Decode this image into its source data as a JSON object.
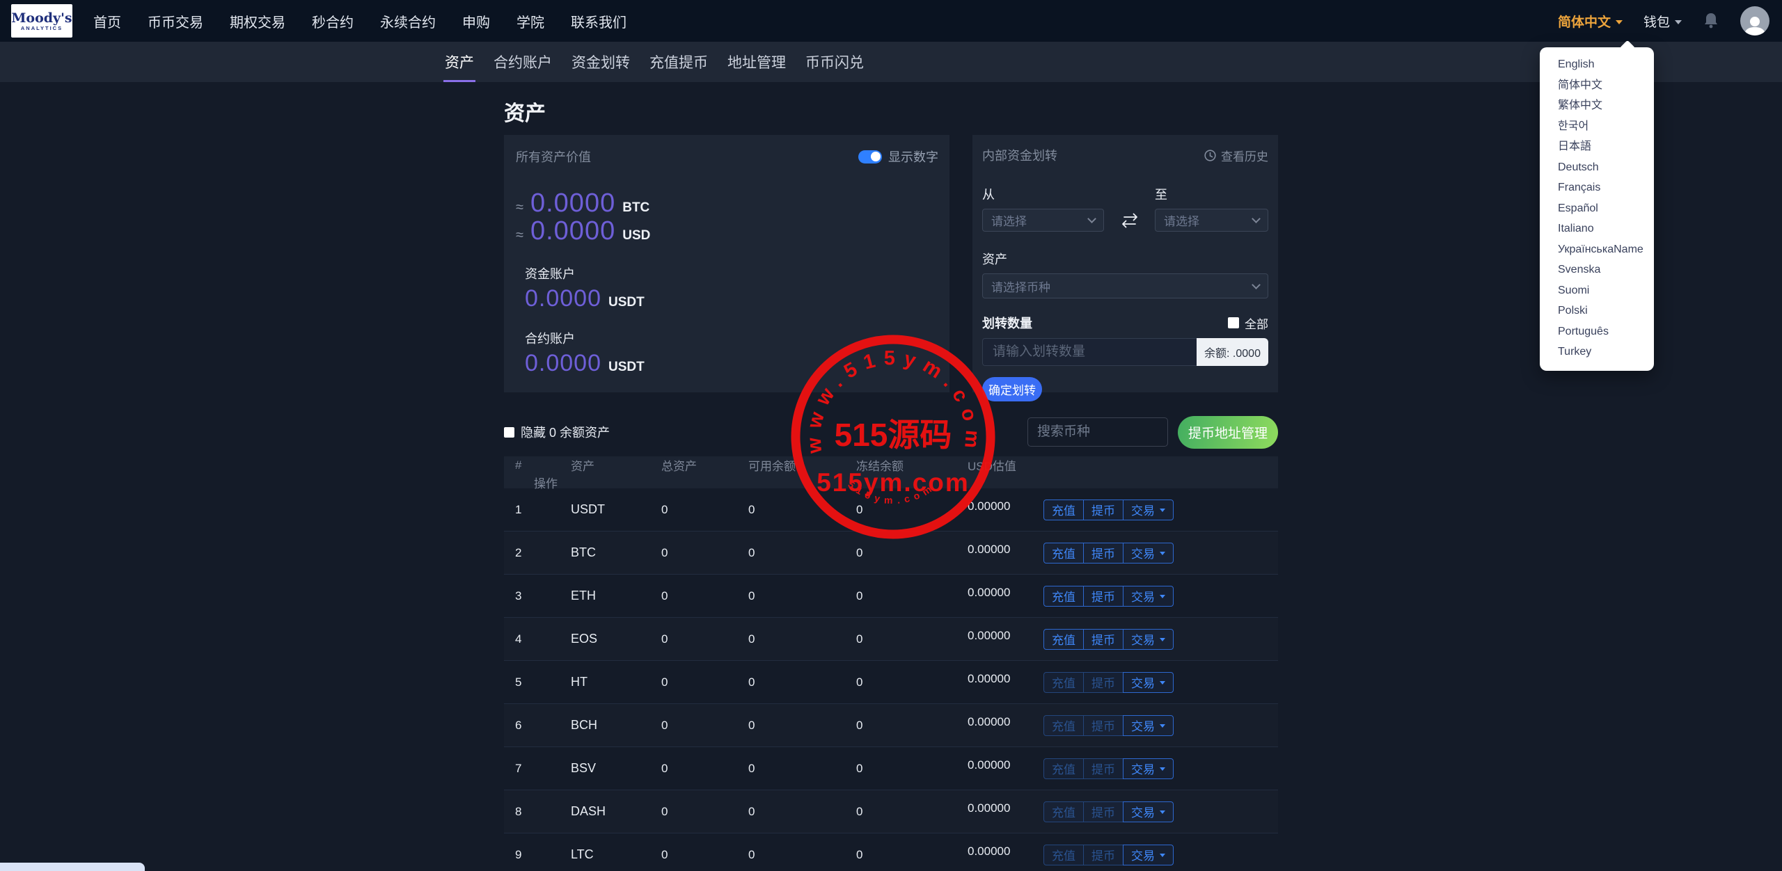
{
  "navbar": {
    "logo": {
      "line1": "Moody's",
      "line2": "ANALYTICS"
    },
    "items": [
      "首页",
      "币币交易",
      "期权交易",
      "秒合约",
      "永续合约",
      "申购",
      "学院",
      "联系我们"
    ],
    "language": "简体中文",
    "wallet": "钱包"
  },
  "language_menu": {
    "items": [
      "English",
      "简体中文",
      "繁体中文",
      "한국어",
      "日本語",
      "Deutsch",
      "Français",
      "Español",
      "Italiano",
      "УкраїнськаName",
      "Svenska",
      "Suomi",
      "Polski",
      "Português",
      "Turkey"
    ]
  },
  "subnav": {
    "items": [
      "资产",
      "合约账户",
      "资金划转",
      "充值提币",
      "地址管理",
      "币币闪兑"
    ],
    "active": "资产"
  },
  "page": {
    "title": "资产"
  },
  "assets_panel": {
    "title": "所有资产价值",
    "toggle_label": "显示数字",
    "toggle_on": true,
    "btc": {
      "approx": "≈",
      "value": "0.0000",
      "unit": "BTC"
    },
    "usd": {
      "approx": "≈",
      "value": "0.0000",
      "unit": "USD"
    },
    "fund_account": {
      "label": "资金账户",
      "value": "0.0000",
      "unit": "USDT"
    },
    "contract_account": {
      "label": "合约账户",
      "value": "0.0000",
      "unit": "USDT"
    }
  },
  "transfer_panel": {
    "title": "内部资金划转",
    "history_link": "查看历史",
    "from_label": "从",
    "to_label": "至",
    "from_placeholder": "请选择",
    "to_placeholder": "请选择",
    "asset_label": "资产",
    "asset_placeholder": "请选择币种",
    "amount_label": "划转数量",
    "all_label": "全部",
    "amount_placeholder": "请输入划转数量",
    "balance_suffix": "余额: .0000",
    "submit_label": "确定划转"
  },
  "filter_bar": {
    "hide_zero_label": "隐藏 0 余额资产",
    "search_placeholder": "搜索币种",
    "address_btn": "提币地址管理"
  },
  "table": {
    "headers": [
      "#",
      "资产",
      "总资产",
      "可用余额",
      "冻结余额",
      "USD估值",
      "操作"
    ],
    "actions": {
      "deposit": "充值",
      "withdraw": "提币",
      "trade": "交易"
    },
    "rows": [
      {
        "index": "1",
        "asset": "USDT",
        "total": "0",
        "available": "0",
        "frozen": "0",
        "usd": "0.00000",
        "dimmed": false
      },
      {
        "index": "2",
        "asset": "BTC",
        "total": "0",
        "available": "0",
        "frozen": "0",
        "usd": "0.00000",
        "dimmed": false
      },
      {
        "index": "3",
        "asset": "ETH",
        "total": "0",
        "available": "0",
        "frozen": "0",
        "usd": "0.00000",
        "dimmed": false
      },
      {
        "index": "4",
        "asset": "EOS",
        "total": "0",
        "available": "0",
        "frozen": "0",
        "usd": "0.00000",
        "dimmed": false
      },
      {
        "index": "5",
        "asset": "HT",
        "total": "0",
        "available": "0",
        "frozen": "0",
        "usd": "0.00000",
        "dimmed": true
      },
      {
        "index": "6",
        "asset": "BCH",
        "total": "0",
        "available": "0",
        "frozen": "0",
        "usd": "0.00000",
        "dimmed": true
      },
      {
        "index": "7",
        "asset": "BSV",
        "total": "0",
        "available": "0",
        "frozen": "0",
        "usd": "0.00000",
        "dimmed": true
      },
      {
        "index": "8",
        "asset": "DASH",
        "total": "0",
        "available": "0",
        "frozen": "0",
        "usd": "0.00000",
        "dimmed": true
      },
      {
        "index": "9",
        "asset": "LTC",
        "total": "0",
        "available": "0",
        "frozen": "0",
        "usd": "0.00000",
        "dimmed": true
      }
    ]
  },
  "watermark": {
    "top_arc": "www.515ym.com",
    "center": "515源码",
    "sub": "515ym.com",
    "bottom_arc": "515ym.com"
  },
  "colors": {
    "accent_orange": "#eda43c",
    "accent_purple": "#6e5fd8",
    "accent_blue": "#3a6df4",
    "button_blue": "#3f87f8",
    "green_start": "#43ae60",
    "green_end": "#8fdb5e",
    "watermark_red": "#ed1111",
    "panel_bg": "#1e2634",
    "page_bg": "#141b28",
    "navbar_bg": "#0a1321"
  }
}
